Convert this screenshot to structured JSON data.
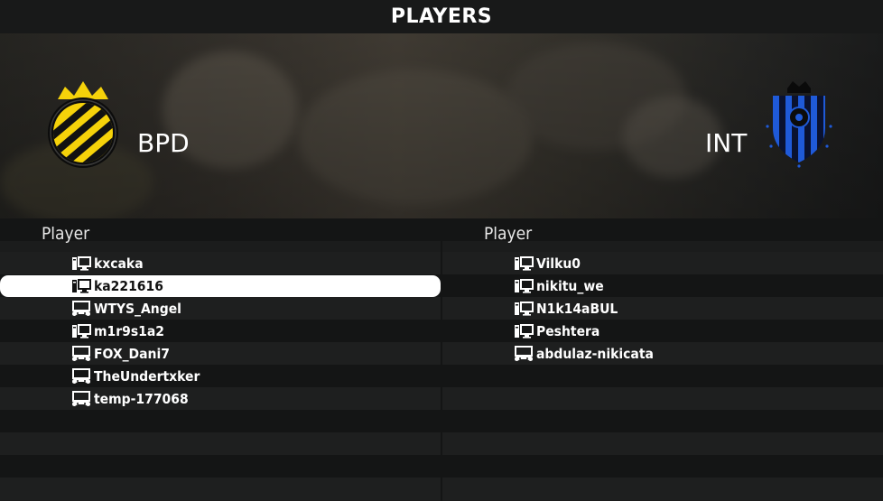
{
  "header": {
    "title": "PLAYERS"
  },
  "home_team": {
    "name": "BPD",
    "crest": "yellow-black-striped-crest-with-crown"
  },
  "away_team": {
    "name": "INT",
    "crest": "blue-black-striped-shield-crest"
  },
  "left_list": {
    "column_header": "Player",
    "selected_index": 1,
    "players": [
      {
        "name": "kxcaka",
        "platform": "pc-icon"
      },
      {
        "name": "ka221616",
        "platform": "pc-icon"
      },
      {
        "name": "WTYS_Angel",
        "platform": "console-icon"
      },
      {
        "name": "m1r9s1a2",
        "platform": "pc-icon"
      },
      {
        "name": "FOX_Dani7",
        "platform": "console-icon"
      },
      {
        "name": "TheUndertxker",
        "platform": "console-icon"
      },
      {
        "name": "temp-177068",
        "platform": "console-icon"
      }
    ]
  },
  "right_list": {
    "column_header": "Player",
    "players": [
      {
        "name": "Vilku0",
        "platform": "pc-icon"
      },
      {
        "name": "nikitu_we",
        "platform": "pc-icon"
      },
      {
        "name": "N1k14aBUL",
        "platform": "pc-icon"
      },
      {
        "name": "Peshtera",
        "platform": "pc-icon"
      },
      {
        "name": "abdulaz-nikicata",
        "platform": "console-icon"
      }
    ]
  },
  "colors": {
    "selected_row": "#ffffff",
    "home_crest": "#f5d20a",
    "away_crest": "#1f5ad8"
  }
}
